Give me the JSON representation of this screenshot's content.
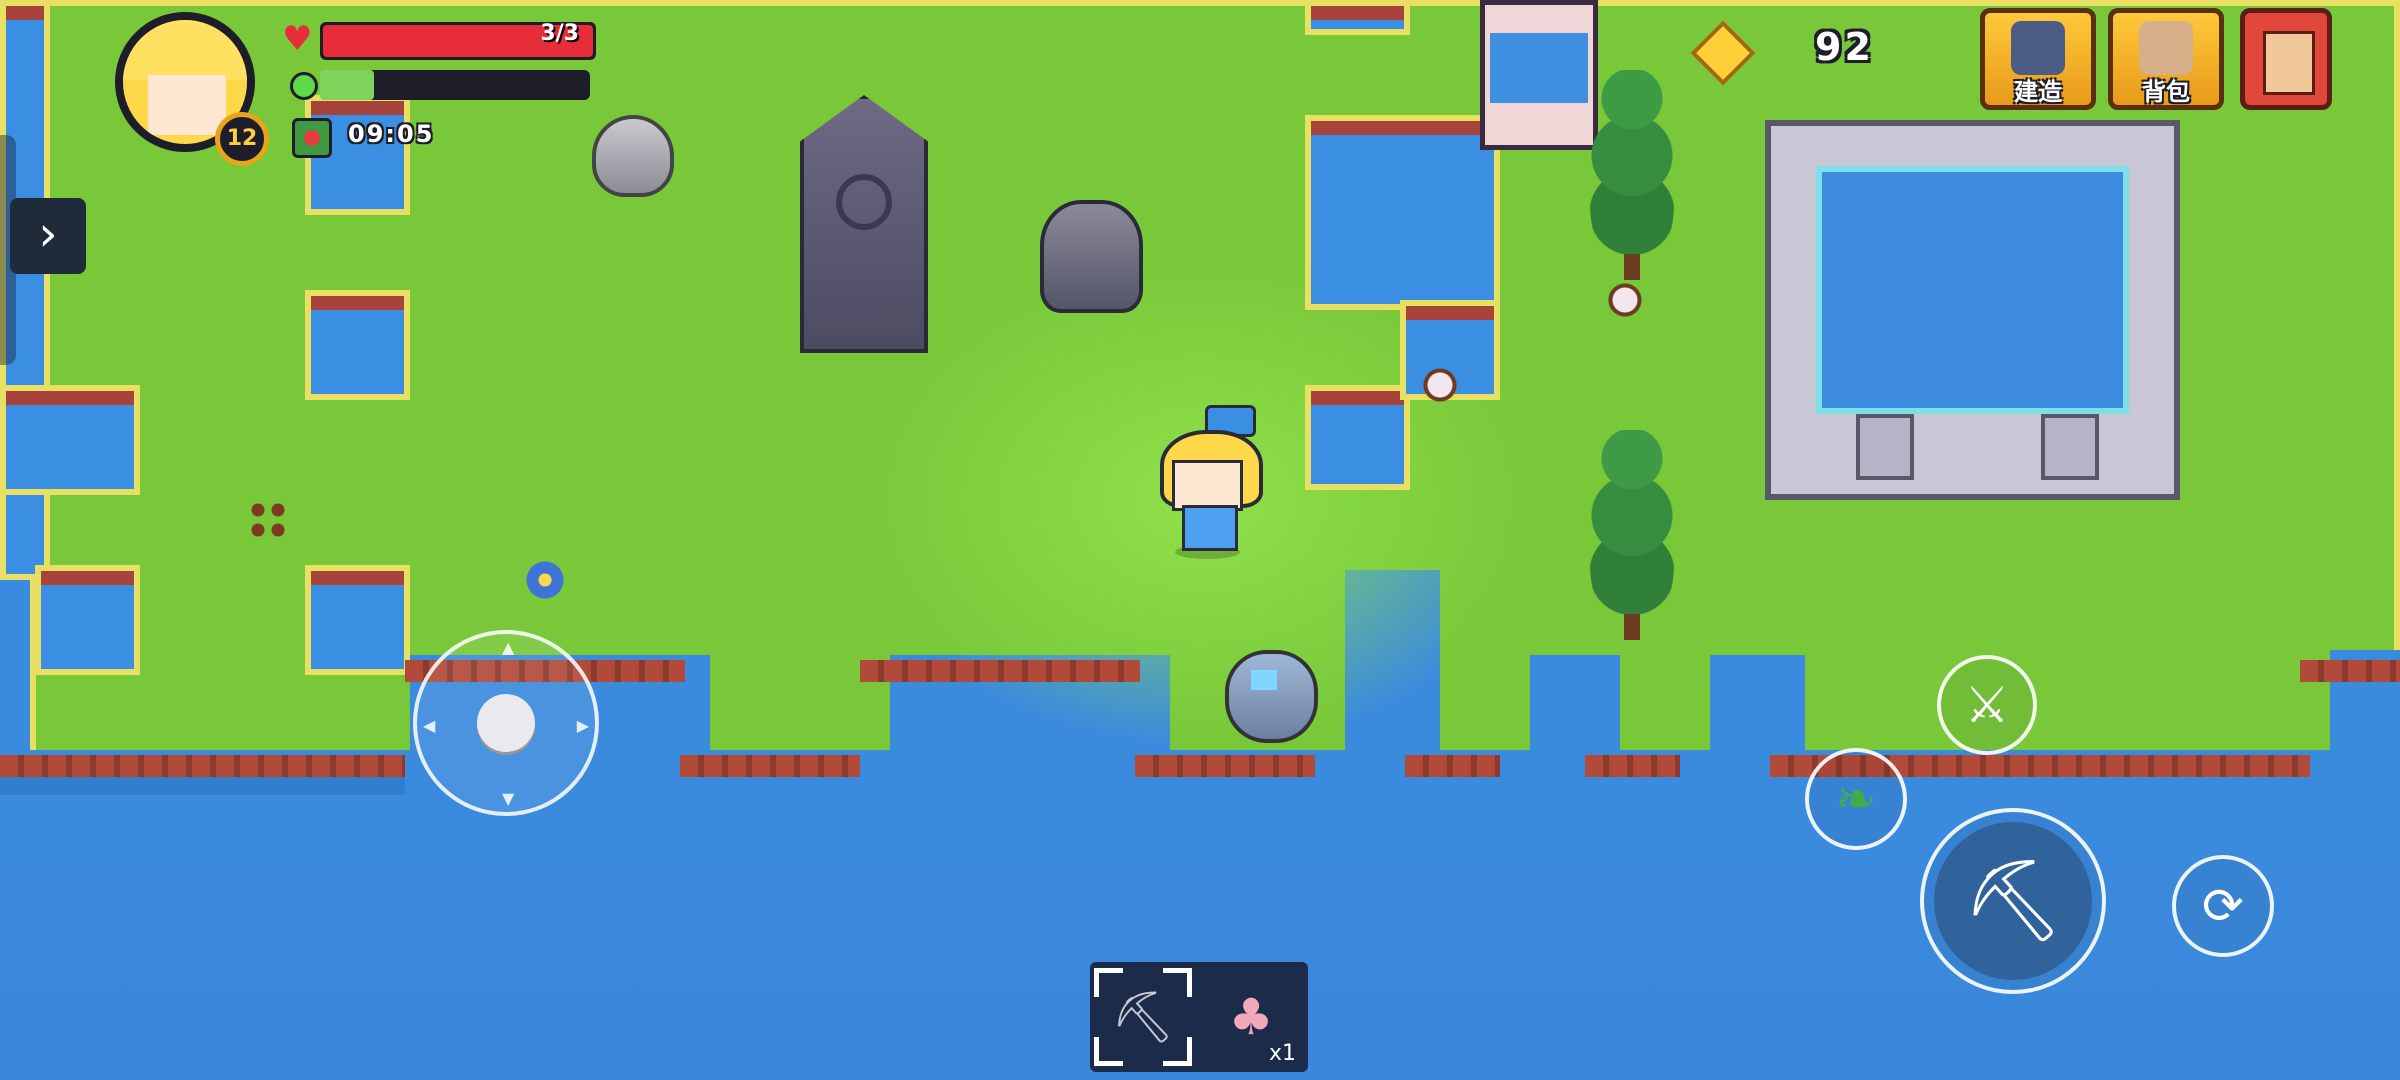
{
  "hud": {
    "level": "12",
    "health_text": "3/3",
    "health_fraction": 1.0,
    "energy_fraction": 0.2,
    "timer": "09:05",
    "coins": "92"
  },
  "menu": {
    "build_label": "建造",
    "backpack_label": "背包"
  },
  "hotbar": {
    "slots": [
      {
        "item": "pickaxe-icon",
        "selected": true,
        "qty": ""
      },
      {
        "item": "beet-icon",
        "selected": false,
        "qty": "x1"
      }
    ]
  },
  "colors": {
    "grass": "#78c83a",
    "water": "#3b8fe3",
    "health": "#e62d38",
    "energy": "#7fd35a",
    "menu_button": "#ffc83a",
    "quest_button": "#e2473c"
  }
}
